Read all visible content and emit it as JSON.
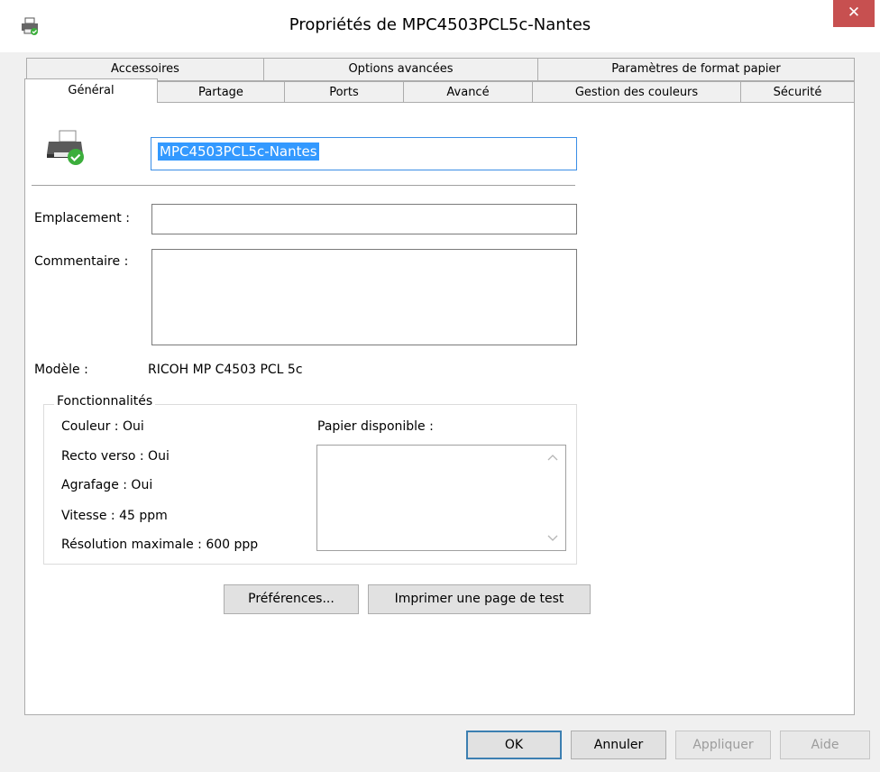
{
  "window": {
    "title": "Propriétés de MPC4503PCL5c-Nantes",
    "close_glyph": "✕"
  },
  "tabs_row1": [
    "Accessoires",
    "Options avancées",
    "Paramètres de format papier"
  ],
  "tabs_row2": [
    "Général",
    "Partage",
    "Ports",
    "Avancé",
    "Gestion des couleurs",
    "Sécurité"
  ],
  "general": {
    "printer_name": "MPC4503PCL5c-Nantes",
    "location_label": "Emplacement :",
    "location_value": "",
    "comment_label": "Commentaire :",
    "comment_value": "",
    "model_label": "Modèle :",
    "model_value": "RICOH MP C4503 PCL 5c",
    "features_title": "Fonctionnalités",
    "features": {
      "color": "Couleur : Oui",
      "duplex": "Recto verso : Oui",
      "staple": "Agrafage : Oui",
      "speed": "Vitesse : 45 ppm",
      "resolution": "Résolution maximale : 600 ppp"
    },
    "paper_label": "Papier disponible :",
    "preferences_button": "Préférences...",
    "test_page_button": "Imprimer une page de test"
  },
  "footer": {
    "ok": "OK",
    "cancel": "Annuler",
    "apply": "Appliquer",
    "help": "Aide"
  },
  "icons": {
    "title": "printer-icon",
    "general": "printer-ok-icon"
  }
}
